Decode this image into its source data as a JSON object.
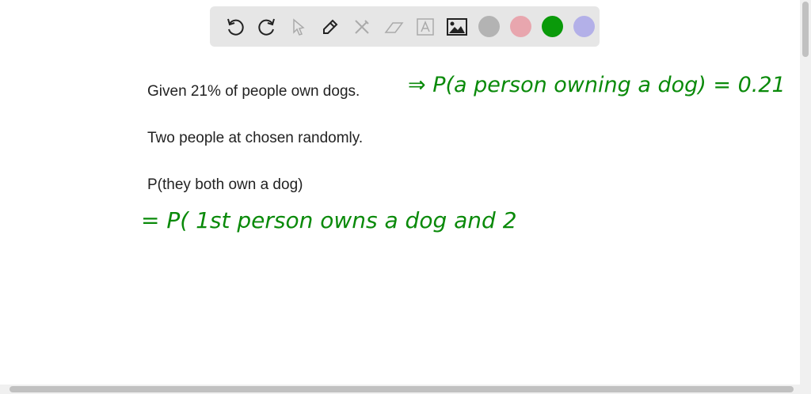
{
  "toolbar": {
    "tools": [
      "undo",
      "redo",
      "select",
      "pen",
      "tools",
      "eraser",
      "text",
      "image"
    ],
    "colors": [
      "#b3b3b3",
      "#e8a6ae",
      "#0a9a0a",
      "#b3b0e8"
    ]
  },
  "lines": {
    "l1": "Given 21% of people own dogs.",
    "l2": "Two people at chosen randomly.",
    "l3": "P(they both own a dog)"
  },
  "handwriting": {
    "h1": "⇒ P(a person owning a dog) = 0.21",
    "h2": "= P( 1st person owns a dog and 2"
  }
}
